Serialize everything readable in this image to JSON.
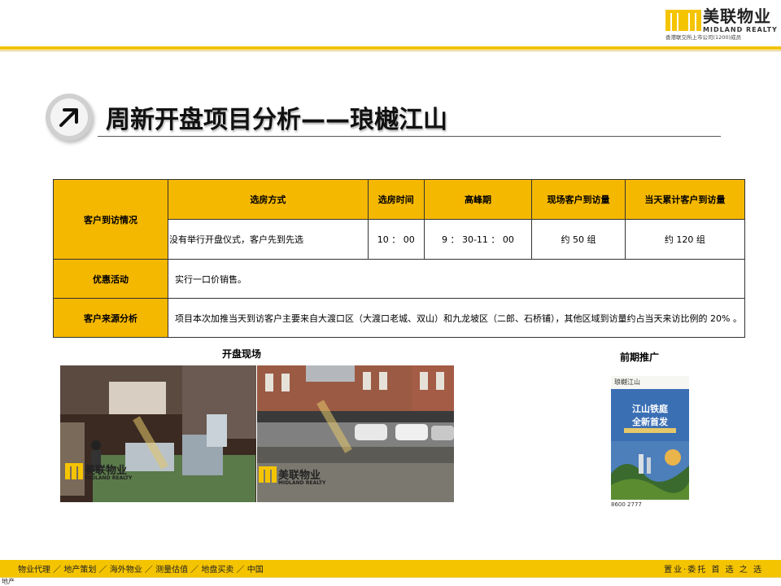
{
  "header": {
    "brand_cn": "美联物业",
    "brand_en": "MIDLAND REALTY",
    "brand_sub": "香港联交所上市公司(1200)成员",
    "colors": {
      "accent": "#f5b800",
      "rule": "#f2c200"
    }
  },
  "title": {
    "icon": "arrow-up-right-icon",
    "text": "周新开盘项目分析——琅樾江山"
  },
  "table": {
    "visit": {
      "label": "客户到访情况",
      "headers": [
        "选房方式",
        "选房时间",
        "高峰期",
        "现场客户到访量",
        "当天累计客户到访量"
      ],
      "values": [
        "没有举行开盘仪式，客户先到先选",
        "10 ： 00",
        "9 ： 30-11 ： 00",
        "约 50 组",
        "约 120 组"
      ]
    },
    "promo": {
      "label": "优惠活动",
      "value": "实行一口价销售。"
    },
    "source": {
      "label": "客户来源分析",
      "value": "项目本次加推当天到访客户主要来自大渡口区（大渡口老城、双山）和九龙坡区（二郎、石桥铺），其他区域到访量约占当天来访比例的 20% 。"
    }
  },
  "photos": {
    "left_label": "开盘现场",
    "right_label": "前期推广",
    "watermark_cn": "美联物业",
    "watermark_en": "MIDLAND REALTY",
    "poster": {
      "brand": "琅樾江山",
      "line1": "江山铁庭",
      "line2": "全新首发",
      "phone": "8600 2777"
    }
  },
  "footer": {
    "items": "物业代理 ／ 地产策划 ／ 海外物业 ／ 测量估值 ／ 地盘买卖 ／ 中国",
    "slogan": "置业·委托 首 选 之 选",
    "corner": "地产"
  }
}
